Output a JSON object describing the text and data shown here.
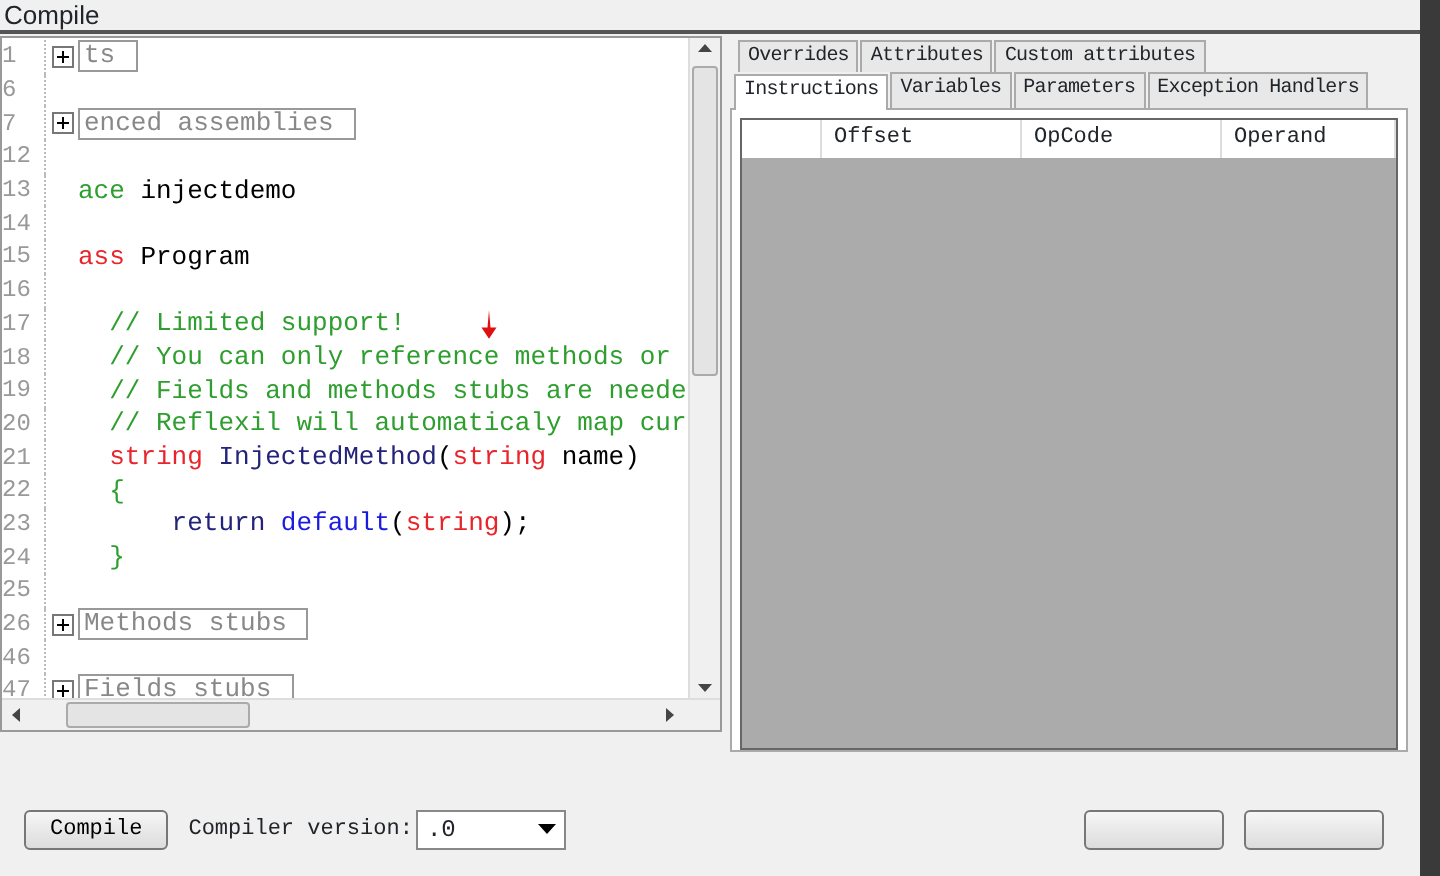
{
  "window": {
    "title": "Compile"
  },
  "editor": {
    "lines": [
      {
        "number": "1",
        "kind": "fold",
        "label": "ts"
      },
      {
        "number": "6",
        "kind": "blank"
      },
      {
        "number": "7",
        "kind": "fold",
        "label": "enced assemblies"
      },
      {
        "number": "12",
        "kind": "blank"
      },
      {
        "number": "13",
        "kind": "code",
        "tokens": [
          {
            "text": "ace",
            "color": "#2e9e2e"
          },
          {
            "text": " injectdemo",
            "color": "#000000"
          }
        ]
      },
      {
        "number": "14",
        "kind": "blank"
      },
      {
        "number": "15",
        "kind": "code",
        "tokens": [
          {
            "text": "ass",
            "color": "#e8252b"
          },
          {
            "text": " Program",
            "color": "#000000"
          }
        ]
      },
      {
        "number": "16",
        "kind": "blank"
      },
      {
        "number": "17",
        "kind": "code",
        "tokens": [
          {
            "text": "  // Limited support!",
            "color": "#2e9e2e"
          }
        ]
      },
      {
        "number": "18",
        "kind": "code",
        "tokens": [
          {
            "text": "  // You can only reference methods or",
            "color": "#2e9e2e"
          }
        ]
      },
      {
        "number": "19",
        "kind": "code",
        "tokens": [
          {
            "text": "  // Fields and methods stubs are neede",
            "color": "#2e9e2e"
          }
        ]
      },
      {
        "number": "20",
        "kind": "code",
        "tokens": [
          {
            "text": "  // Reflexil will automaticaly map cur",
            "color": "#2e9e2e"
          }
        ]
      },
      {
        "number": "21",
        "kind": "code",
        "tokens": [
          {
            "text": "  string",
            "color": "#e8252b"
          },
          {
            "text": " InjectedMethod",
            "color": "#23237a"
          },
          {
            "text": "(",
            "color": "#000000"
          },
          {
            "text": "string",
            "color": "#e8252b"
          },
          {
            "text": " name)",
            "color": "#000000"
          }
        ]
      },
      {
        "number": "22",
        "kind": "code",
        "tokens": [
          {
            "text": "  {",
            "color": "#2e9e2e"
          }
        ]
      },
      {
        "number": "23",
        "kind": "code",
        "tokens": [
          {
            "text": "      return",
            "color": "#23237a"
          },
          {
            "text": " default",
            "color": "#1a1ae0"
          },
          {
            "text": "(",
            "color": "#000000"
          },
          {
            "text": "string",
            "color": "#e8252b"
          },
          {
            "text": ");",
            "color": "#000000"
          }
        ]
      },
      {
        "number": "24",
        "kind": "code",
        "tokens": [
          {
            "text": "  }",
            "color": "#2e9e2e"
          }
        ]
      },
      {
        "number": "25",
        "kind": "blank"
      },
      {
        "number": "26",
        "kind": "fold",
        "label": "Methods stubs"
      },
      {
        "number": "46",
        "kind": "blank"
      },
      {
        "number": "47",
        "kind": "fold",
        "label": "Fields stubs"
      }
    ]
  },
  "tabs_back": [
    {
      "label": "Overrides",
      "selected": false
    },
    {
      "label": "Attributes",
      "selected": false
    },
    {
      "label": "Custom attributes",
      "selected": false
    }
  ],
  "tabs_front": [
    {
      "label": "Instructions",
      "selected": true
    },
    {
      "label": "Variables",
      "selected": false
    },
    {
      "label": "Parameters",
      "selected": false
    },
    {
      "label": "Exception Handlers",
      "selected": false
    }
  ],
  "grid": {
    "columns": [
      "Offset",
      "OpCode",
      "Operand"
    ]
  },
  "footer": {
    "compile_button": "Compile",
    "version_label": "Compiler version:",
    "version_value": ".0"
  }
}
